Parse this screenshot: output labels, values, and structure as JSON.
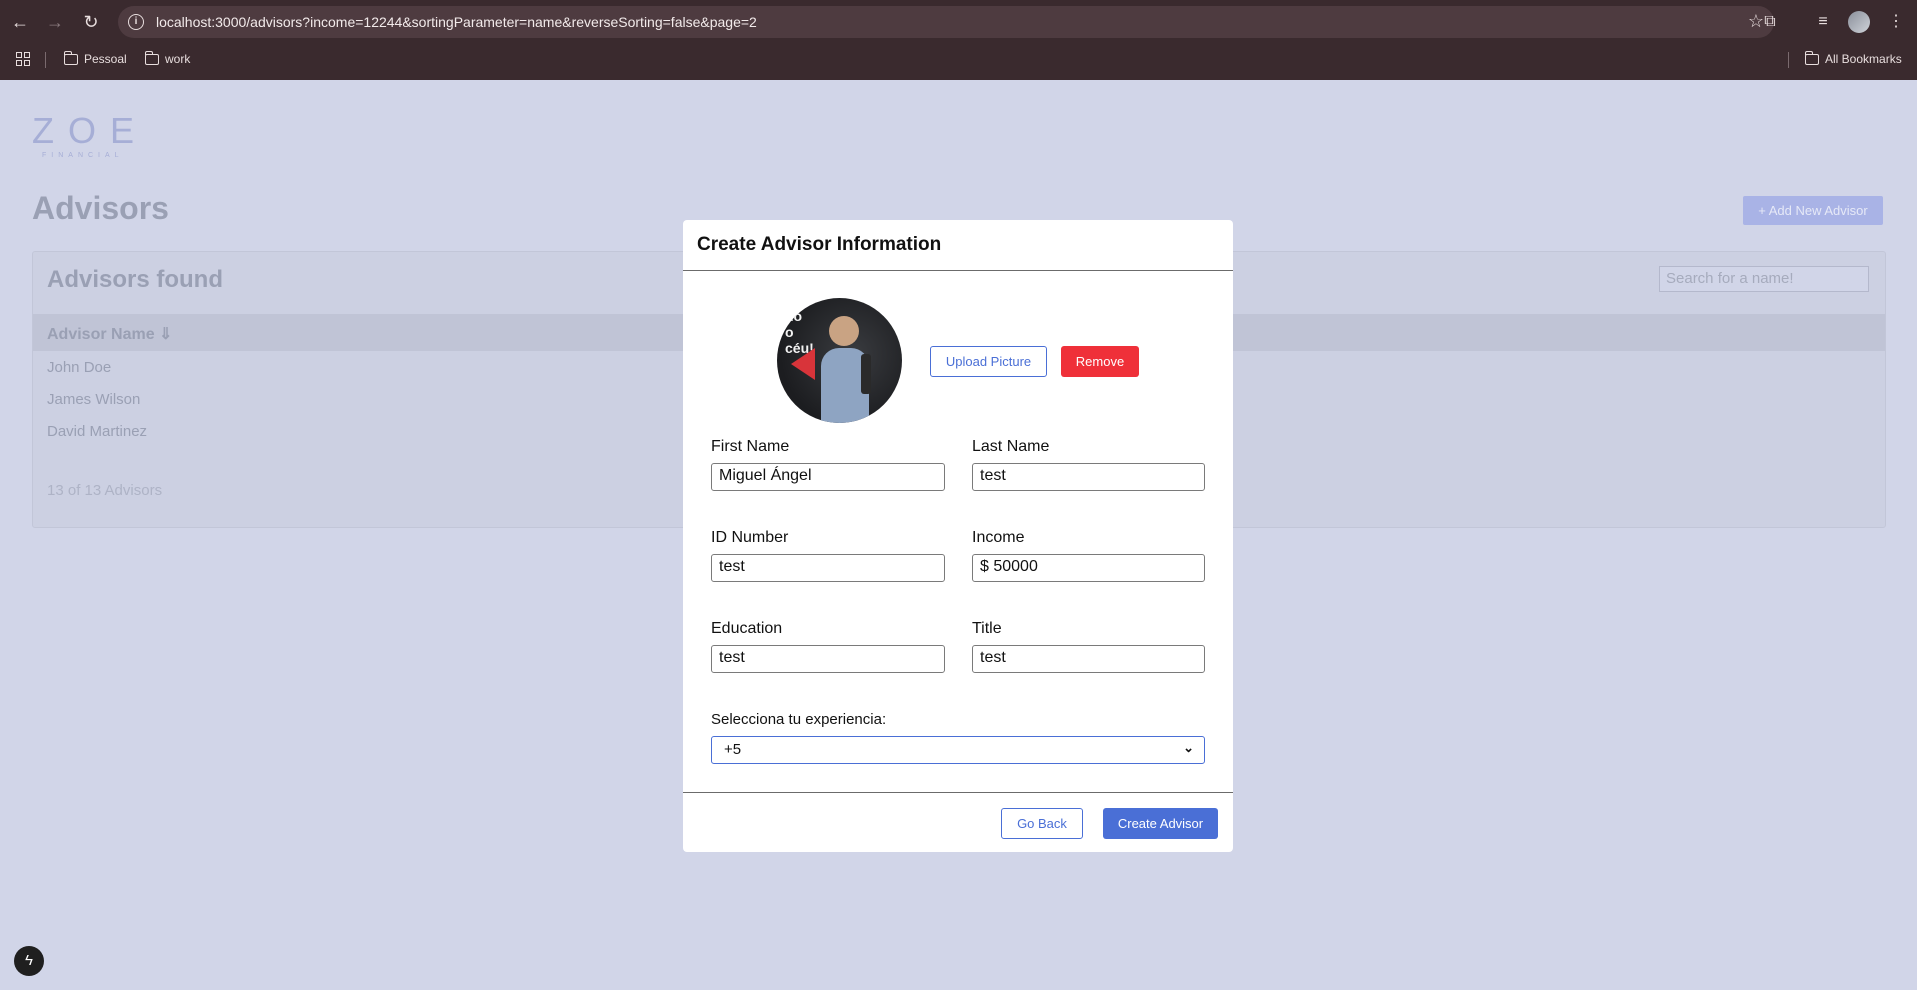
{
  "browser": {
    "url": "localhost:3000/advisors?income=12244&sortingParameter=name&reverseSorting=false&page=2",
    "bookmarks": [
      "Pessoal",
      "work"
    ],
    "all_bookmarks_label": "All Bookmarks"
  },
  "page": {
    "logo_main": "ZOE",
    "logo_sub": "FINANCIAL",
    "title": "Advisors",
    "add_button": "+ Add New Advisor",
    "card_title": "Advisors found",
    "search_placeholder": "Search for a name!",
    "column_header": "Advisor Name ⇓",
    "rows": [
      "John Doe",
      "James Wilson",
      "David Martinez"
    ],
    "count": "13 of 13 Advisors"
  },
  "modal": {
    "title": "Create Advisor Information",
    "avatar_text": "no\no\ncéu!",
    "upload_label": "Upload Picture",
    "remove_label": "Remove",
    "fields": {
      "first_name": {
        "label": "First Name",
        "value": "Miguel Ángel"
      },
      "last_name": {
        "label": "Last Name",
        "value": "test"
      },
      "id_number": {
        "label": "ID Number",
        "value": "test"
      },
      "income": {
        "label": "Income",
        "value": "$ 50000"
      },
      "education": {
        "label": "Education",
        "value": "test"
      },
      "title": {
        "label": "Title",
        "value": "test"
      }
    },
    "experience_label": "Selecciona tu experiencia:",
    "experience_value": "+5",
    "go_back_label": "Go Back",
    "create_label": "Create Advisor"
  },
  "colors": {
    "accent": "#4a6fd6",
    "danger": "#ef3039",
    "backdrop": "#d1d5e8",
    "chrome": "#3a2a2e"
  },
  "icons": [
    "back-arrow-icon",
    "forward-arrow-icon",
    "reload-icon",
    "site-info-icon",
    "star-icon",
    "extensions-icon",
    "media-control-icon",
    "menu-dots-icon",
    "apps-grid-icon",
    "folder-icon",
    "bolt-icon",
    "chevron-down-icon"
  ]
}
